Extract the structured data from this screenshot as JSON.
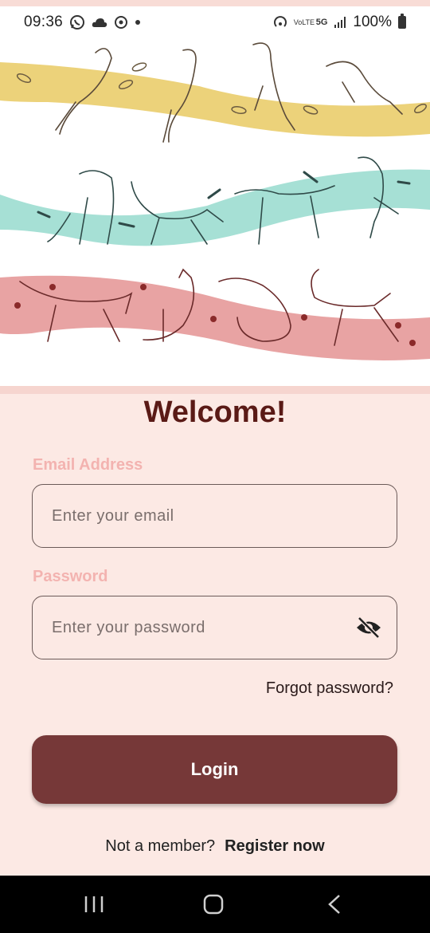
{
  "status_bar": {
    "time": "09:36",
    "battery_percent": "100%",
    "left_icons": [
      "whatsapp-icon",
      "cloud-icon",
      "sync-icon",
      "dot-icon"
    ],
    "right_icons": [
      "hotspot-icon",
      "volte-icon",
      "5g-icon",
      "signal-icon",
      "battery-icon"
    ],
    "volte_text": "VoLTE",
    "network_text": "5G"
  },
  "hero": {
    "bands": [
      "birds",
      "dogs",
      "cats"
    ],
    "colors": {
      "birds": "#ecd27a",
      "dogs": "#a6e0d5",
      "cats": "#e8a3a3"
    }
  },
  "welcome_title": "Welcome!",
  "email": {
    "label": "Email Address",
    "placeholder": "Enter your email",
    "value": ""
  },
  "password": {
    "label": "Password",
    "placeholder": "Enter your password",
    "value": "",
    "visibility_icon": "eye-off-icon"
  },
  "forgot_password": "Forgot password?",
  "login_label": "Login",
  "register": {
    "prompt": "Not a member?",
    "link": "Register now"
  },
  "navigation": {
    "buttons": [
      "recents-icon",
      "home-icon",
      "back-icon"
    ]
  },
  "colors": {
    "background": "#fce9e4",
    "title": "#5a1a16",
    "label": "#f3b3b0",
    "button": "#763838"
  }
}
